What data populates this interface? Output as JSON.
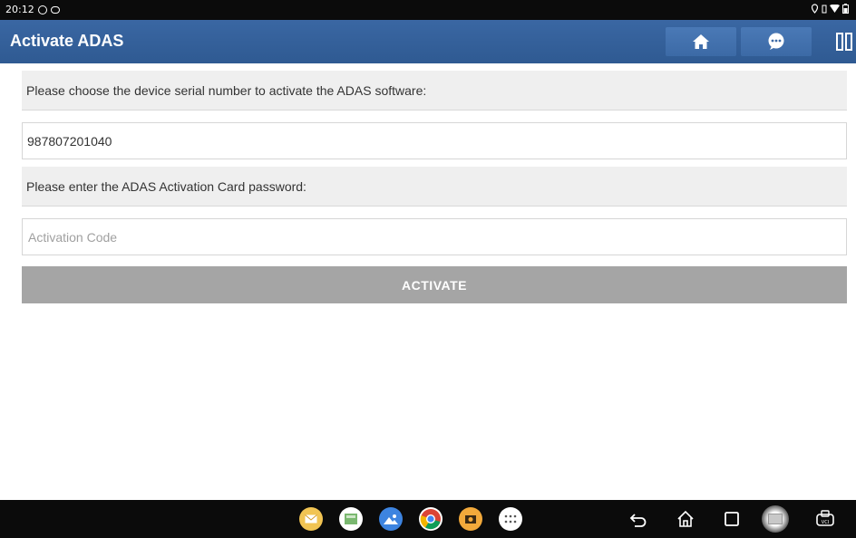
{
  "status_bar": {
    "time": "20:12"
  },
  "header": {
    "title": "Activate ADAS"
  },
  "form": {
    "serial_prompt": "Please choose the device serial number to activate the ADAS software:",
    "serial_value": "987807201040",
    "password_prompt": "Please enter the ADAS Activation Card password:",
    "code_placeholder": "Activation Code",
    "code_value": "",
    "activate_label": "ACTIVATE"
  },
  "taskbar": {
    "apps": [
      "email-app-icon",
      "gallery-app-icon",
      "photos-app-icon",
      "chrome-app-icon",
      "camera-app-icon",
      "app-drawer-icon"
    ],
    "nav": [
      "back-icon",
      "home-nav-icon",
      "recents-icon",
      "screenshot-icon",
      "vci-icon"
    ]
  },
  "colors": {
    "header_bg": "#2f5a92",
    "button_disabled": "#a5a5a5",
    "label_bg": "#efefef"
  }
}
